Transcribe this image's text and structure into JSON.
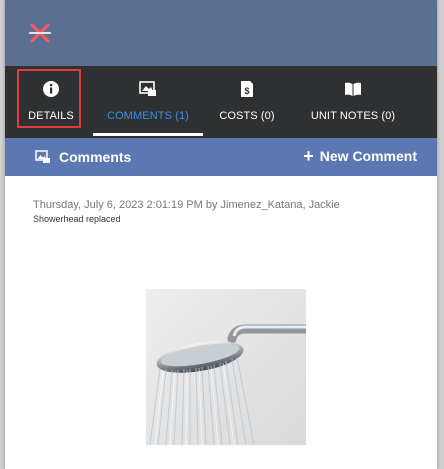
{
  "colors": {
    "topbar": "#5b6f92",
    "tabbar": "#2f3032",
    "section_bar": "#5b78b3",
    "active_tab_text": "#3d8fe6",
    "highlight_box": "#e23b3b",
    "close_icon": "#ff5a5a"
  },
  "header": {
    "close_icon": "close-x-icon"
  },
  "tabs": [
    {
      "label": "DETAILS",
      "icon": "info-circle-icon",
      "active": false,
      "highlighted": true
    },
    {
      "label": "COMMENTS (1)",
      "icon": "image-comment-icon",
      "active": true
    },
    {
      "label": "COSTS (0)",
      "icon": "receipt-dollar-icon",
      "active": false
    },
    {
      "label": "UNIT NOTES (0)",
      "icon": "open-book-icon",
      "active": false
    }
  ],
  "section": {
    "title": "Comments",
    "title_icon": "image-comment-icon",
    "new_comment_label": "New Comment",
    "new_comment_icon": "plus-icon"
  },
  "comment": {
    "meta": "Thursday, July 6, 2023 2:01:19 PM by Jimenez_Katana, Jackie",
    "text": "Showerhead replaced",
    "attachment": "showerhead-photo"
  }
}
